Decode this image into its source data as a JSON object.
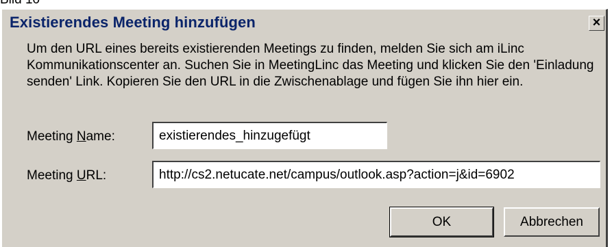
{
  "caption": "Bild 10",
  "dialog": {
    "title": "Existierendes Meeting hinzufügen",
    "close_glyph": "×",
    "instructions": "Um den URL eines bereits existierenden Meetings zu finden, melden Sie sich am iLinc Kommunikationscenter an. Suchen Sie in MeetingLinc das Meeting und klicken Sie den 'Einladung senden' Link. Kopieren Sie den URL in die Zwischenablage und fügen Sie ihn hier ein.",
    "fields": {
      "name": {
        "label_prefix": "Meeting ",
        "label_mnemonic": "N",
        "label_suffix": "ame:",
        "value": "existierendes_hinzugefügt"
      },
      "url": {
        "label_prefix": "Meeting ",
        "label_mnemonic": "U",
        "label_suffix": "RL:",
        "value": "http://cs2.netucate.net/campus/outlook.asp?action=j&id=6902"
      }
    },
    "buttons": {
      "ok": "OK",
      "cancel": "Abbrechen"
    }
  }
}
